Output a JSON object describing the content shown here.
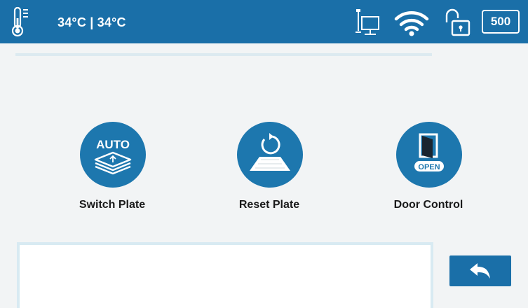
{
  "status_bar": {
    "temperature": "34°C | 34°C",
    "counter": "500",
    "icons": [
      "thermometer-icon",
      "network-icon",
      "wifi-icon",
      "lock-icon"
    ]
  },
  "actions": [
    {
      "id": "switch",
      "label": "Switch Plate",
      "icon": "auto-plate-icon",
      "icon_text": "AUTO"
    },
    {
      "id": "reset",
      "label": "Reset Plate",
      "icon": "reset-plate-icon"
    },
    {
      "id": "door",
      "label": "Door Control",
      "icon": "door-open-icon",
      "icon_text": "OPEN"
    }
  ],
  "message_box": {
    "text": ""
  },
  "footer": {
    "back_icon": "back-arrow-icon"
  },
  "colors": {
    "primary": "#1a6fa8",
    "circle": "#1d77ae",
    "background": "#f2f4f5",
    "accent_line": "#dceaf0"
  }
}
